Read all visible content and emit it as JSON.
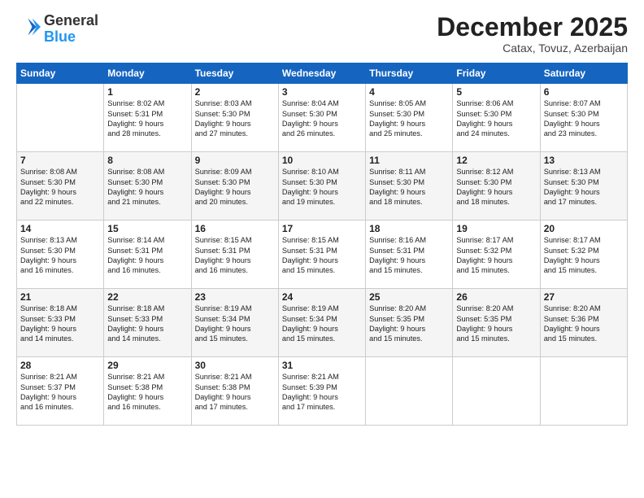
{
  "logo": {
    "general": "General",
    "blue": "Blue"
  },
  "header": {
    "title": "December 2025",
    "location": "Catax, Tovuz, Azerbaijan"
  },
  "days_of_week": [
    "Sunday",
    "Monday",
    "Tuesday",
    "Wednesday",
    "Thursday",
    "Friday",
    "Saturday"
  ],
  "weeks": [
    [
      {
        "day": "",
        "info": ""
      },
      {
        "day": "1",
        "info": "Sunrise: 8:02 AM\nSunset: 5:31 PM\nDaylight: 9 hours\nand 28 minutes."
      },
      {
        "day": "2",
        "info": "Sunrise: 8:03 AM\nSunset: 5:30 PM\nDaylight: 9 hours\nand 27 minutes."
      },
      {
        "day": "3",
        "info": "Sunrise: 8:04 AM\nSunset: 5:30 PM\nDaylight: 9 hours\nand 26 minutes."
      },
      {
        "day": "4",
        "info": "Sunrise: 8:05 AM\nSunset: 5:30 PM\nDaylight: 9 hours\nand 25 minutes."
      },
      {
        "day": "5",
        "info": "Sunrise: 8:06 AM\nSunset: 5:30 PM\nDaylight: 9 hours\nand 24 minutes."
      },
      {
        "day": "6",
        "info": "Sunrise: 8:07 AM\nSunset: 5:30 PM\nDaylight: 9 hours\nand 23 minutes."
      }
    ],
    [
      {
        "day": "7",
        "info": "Sunrise: 8:08 AM\nSunset: 5:30 PM\nDaylight: 9 hours\nand 22 minutes."
      },
      {
        "day": "8",
        "info": "Sunrise: 8:08 AM\nSunset: 5:30 PM\nDaylight: 9 hours\nand 21 minutes."
      },
      {
        "day": "9",
        "info": "Sunrise: 8:09 AM\nSunset: 5:30 PM\nDaylight: 9 hours\nand 20 minutes."
      },
      {
        "day": "10",
        "info": "Sunrise: 8:10 AM\nSunset: 5:30 PM\nDaylight: 9 hours\nand 19 minutes."
      },
      {
        "day": "11",
        "info": "Sunrise: 8:11 AM\nSunset: 5:30 PM\nDaylight: 9 hours\nand 18 minutes."
      },
      {
        "day": "12",
        "info": "Sunrise: 8:12 AM\nSunset: 5:30 PM\nDaylight: 9 hours\nand 18 minutes."
      },
      {
        "day": "13",
        "info": "Sunrise: 8:13 AM\nSunset: 5:30 PM\nDaylight: 9 hours\nand 17 minutes."
      }
    ],
    [
      {
        "day": "14",
        "info": "Sunrise: 8:13 AM\nSunset: 5:30 PM\nDaylight: 9 hours\nand 16 minutes."
      },
      {
        "day": "15",
        "info": "Sunrise: 8:14 AM\nSunset: 5:31 PM\nDaylight: 9 hours\nand 16 minutes."
      },
      {
        "day": "16",
        "info": "Sunrise: 8:15 AM\nSunset: 5:31 PM\nDaylight: 9 hours\nand 16 minutes."
      },
      {
        "day": "17",
        "info": "Sunrise: 8:15 AM\nSunset: 5:31 PM\nDaylight: 9 hours\nand 15 minutes."
      },
      {
        "day": "18",
        "info": "Sunrise: 8:16 AM\nSunset: 5:31 PM\nDaylight: 9 hours\nand 15 minutes."
      },
      {
        "day": "19",
        "info": "Sunrise: 8:17 AM\nSunset: 5:32 PM\nDaylight: 9 hours\nand 15 minutes."
      },
      {
        "day": "20",
        "info": "Sunrise: 8:17 AM\nSunset: 5:32 PM\nDaylight: 9 hours\nand 15 minutes."
      }
    ],
    [
      {
        "day": "21",
        "info": "Sunrise: 8:18 AM\nSunset: 5:33 PM\nDaylight: 9 hours\nand 14 minutes."
      },
      {
        "day": "22",
        "info": "Sunrise: 8:18 AM\nSunset: 5:33 PM\nDaylight: 9 hours\nand 14 minutes."
      },
      {
        "day": "23",
        "info": "Sunrise: 8:19 AM\nSunset: 5:34 PM\nDaylight: 9 hours\nand 15 minutes."
      },
      {
        "day": "24",
        "info": "Sunrise: 8:19 AM\nSunset: 5:34 PM\nDaylight: 9 hours\nand 15 minutes."
      },
      {
        "day": "25",
        "info": "Sunrise: 8:20 AM\nSunset: 5:35 PM\nDaylight: 9 hours\nand 15 minutes."
      },
      {
        "day": "26",
        "info": "Sunrise: 8:20 AM\nSunset: 5:35 PM\nDaylight: 9 hours\nand 15 minutes."
      },
      {
        "day": "27",
        "info": "Sunrise: 8:20 AM\nSunset: 5:36 PM\nDaylight: 9 hours\nand 15 minutes."
      }
    ],
    [
      {
        "day": "28",
        "info": "Sunrise: 8:21 AM\nSunset: 5:37 PM\nDaylight: 9 hours\nand 16 minutes."
      },
      {
        "day": "29",
        "info": "Sunrise: 8:21 AM\nSunset: 5:38 PM\nDaylight: 9 hours\nand 16 minutes."
      },
      {
        "day": "30",
        "info": "Sunrise: 8:21 AM\nSunset: 5:38 PM\nDaylight: 9 hours\nand 17 minutes."
      },
      {
        "day": "31",
        "info": "Sunrise: 8:21 AM\nSunset: 5:39 PM\nDaylight: 9 hours\nand 17 minutes."
      },
      {
        "day": "",
        "info": ""
      },
      {
        "day": "",
        "info": ""
      },
      {
        "day": "",
        "info": ""
      }
    ]
  ]
}
